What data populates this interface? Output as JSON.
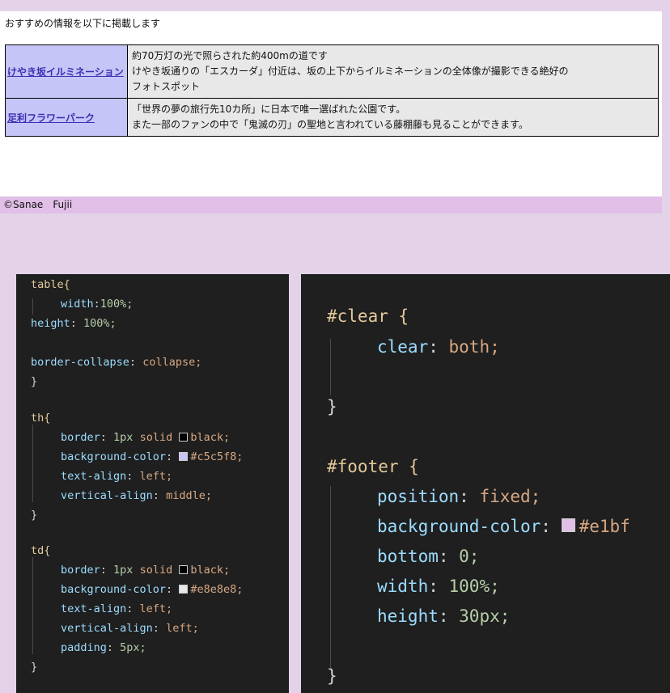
{
  "preview": {
    "intro": "おすすめの情報を以下に掲載します",
    "rows": [
      {
        "name": "けやき坂イルミネーション",
        "lines": [
          "約70万灯の光で照らされた約400mの道です",
          "けやき坂通りの「エスカーダ」付近は、坂の上下からイルミネーションの全体像が撮影できる絶好の",
          "フォトスポット"
        ]
      },
      {
        "name": "足利フラワーパーク",
        "lines": [
          "「世界の夢の旅行先10カ所」に日本で唯一選ばれた公園です。",
          "また一部のファンの中で「鬼滅の刃」の聖地と言われている藤棚藤も見ることができます。"
        ]
      }
    ],
    "footer": "©Sanae　Fujii"
  },
  "colors": {
    "th_bg": "#c5c5f8",
    "td_bg": "#e8e8e8",
    "footer_bg": "#e1bfe7",
    "editor_bg": "#1f1f1f"
  },
  "code_left": {
    "table_sel": "table{",
    "table_width_prop": "width",
    "table_width_val": "100%;",
    "table_height_prop": "height",
    "table_height_val": "100%;",
    "table_bc_prop": "border-collapse",
    "table_bc_val": "collapse;",
    "close": "}",
    "th_sel": "th{",
    "td_sel": "td{",
    "border_prop": "border",
    "border_val_a": "1px",
    "border_val_b": "solid",
    "border_val_c": "black;",
    "bgc_prop": "background-color",
    "th_bg_val": "#c5c5f8;",
    "td_bg_val": "#e8e8e8;",
    "ta_prop": "text-align",
    "ta_val": "left;",
    "va_prop": "vertical-align",
    "va_th_val": "middle;",
    "va_td_val": "left;",
    "pad_prop": "padding",
    "pad_val": "5px;"
  },
  "code_right": {
    "clear_sel": "#clear {",
    "clear_prop": "clear",
    "clear_val": "both;",
    "close": "}",
    "footer_sel": "#footer {",
    "pos_prop": "position",
    "pos_val": "fixed;",
    "bgc_prop": "background-color",
    "bgc_val": "#e1bf",
    "bottom_prop": "bottom",
    "bottom_val": "0;",
    "width_prop": "width",
    "width_val": "100%;",
    "height_prop": "height",
    "height_val": "30px;"
  }
}
